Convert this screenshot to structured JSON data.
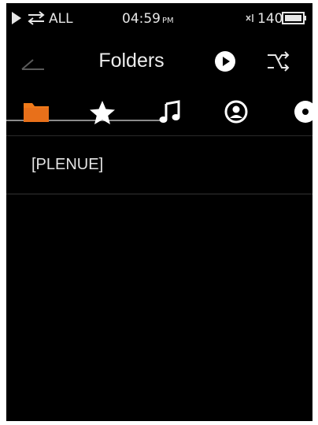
{
  "status_bar": {
    "play_state_icon": "play-triangle",
    "repeat_icon": "repeat-all",
    "repeat_mode": "ALL",
    "time": "04:59",
    "ampm": "PM",
    "track_count_icon": "track-count",
    "track_count": "140",
    "battery_icon": "battery-full"
  },
  "header": {
    "title": "Folders",
    "back_icon": "back-arrow",
    "now_playing_icon": "play-circle",
    "shuffle_icon": "shuffle"
  },
  "tabs": [
    {
      "name": "folders",
      "icon": "folder",
      "active": true
    },
    {
      "name": "favorites",
      "icon": "star",
      "active": false
    },
    {
      "name": "songs",
      "icon": "music-note",
      "active": false
    },
    {
      "name": "artists",
      "icon": "person-circle",
      "active": false
    },
    {
      "name": "albums",
      "icon": "disc",
      "active": false
    }
  ],
  "folder_list": {
    "items": [
      {
        "label": "[PLENUE]"
      }
    ]
  },
  "colors": {
    "background": "#000000",
    "active_tab": "#f07a1a",
    "text": "#e6e6e6",
    "inactive_icon": "#ffffff"
  }
}
